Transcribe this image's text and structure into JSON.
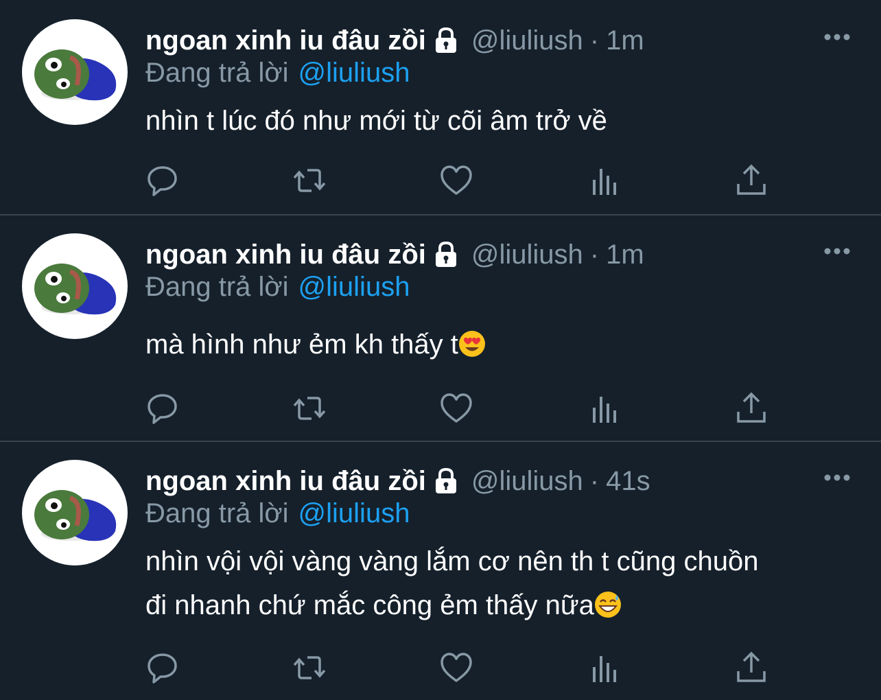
{
  "tweets": [
    {
      "display_name": "ngoan xinh iu đâu zồi",
      "handle": "@liuliush",
      "separator": "·",
      "time": "1m",
      "reply_prefix": "Đang trả lời",
      "reply_to": "@liuliush",
      "text_lines": [
        "nhìn t lúc đó như mới từ cõi âm trở về"
      ],
      "emoji": null
    },
    {
      "display_name": "ngoan xinh iu đâu zồi",
      "handle": "@liuliush",
      "separator": "·",
      "time": "1m",
      "reply_prefix": "Đang trả lời",
      "reply_to": "@liuliush",
      "text_lines": [
        "mà hình như ẻm kh thấy t"
      ],
      "emoji": "heart-eyes-emoji"
    },
    {
      "display_name": "ngoan xinh iu đâu zồi",
      "handle": "@liuliush",
      "separator": "·",
      "time": "41s",
      "reply_prefix": "Đang trả lời",
      "reply_to": "@liuliush",
      "text_lines": [
        "nhìn vội vội vàng vàng lắm cơ nên th t cũng chuồn",
        "đi nhanh chứ mắc công ẻm thấy nữa"
      ],
      "emoji": "grinning-sweat-emoji"
    }
  ],
  "icons": {
    "lock": "lock-icon",
    "more": "more-icon",
    "reply": "reply-icon",
    "retweet": "retweet-icon",
    "like": "like-icon",
    "analytics": "analytics-icon",
    "share": "share-icon"
  },
  "colors": {
    "background": "#15202b",
    "divider": "#38444d",
    "secondary_text": "#8899a6",
    "accent": "#1da1f2",
    "primary_text": "#ffffff"
  }
}
